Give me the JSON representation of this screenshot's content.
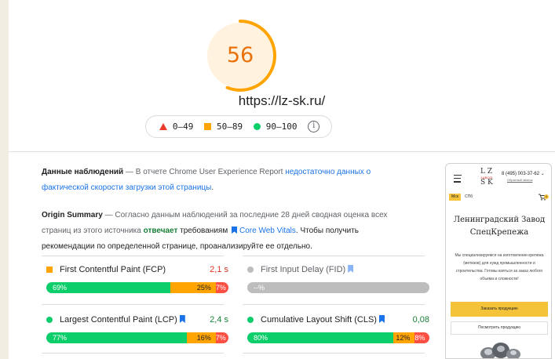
{
  "summary": {
    "score": "56",
    "score_fraction": 0.56,
    "score_color": "#e8710a",
    "url": "https://lz-sk.ru/",
    "legend": {
      "poor": "0–49",
      "average": "50–89",
      "good": "90–100",
      "info_icon": "i"
    }
  },
  "field_data": {
    "title": "Данные наблюдений",
    "dash": " — В отчете Chrome User Experience Report ",
    "link": "недостаточно данных о фактической скорости загрузки этой страницы",
    "end": "."
  },
  "origin": {
    "title": "Origin Summary",
    "text1": " — Согласно данным наблюдений за последние 28 дней сводная оценка всех страниц из этого источника ",
    "status": "отвечает",
    "text2": " требованиям ",
    "cwv": "Core Web Vitals",
    "text3": ". Чтобы получить рекомендации по определенной странице, проанализируйте ее отдельно."
  },
  "metrics": {
    "fcp": {
      "name": "First Contentful Paint (FCP)",
      "value": "2,1 s",
      "value_color": "#d93025",
      "good": "69%",
      "avg": "25%",
      "poor": "7%",
      "good_pct": 69,
      "avg_pct": 25,
      "poor_pct": 7
    },
    "fid": {
      "name": "First Input Delay (FID)",
      "value": "",
      "na": "--%"
    },
    "lcp": {
      "name": "Largest Contentful Paint (LCP)",
      "value": "2,4 s",
      "value_color": "#188038",
      "good": "77%",
      "avg": "16%",
      "poor": "7%",
      "good_pct": 77,
      "avg_pct": 16,
      "poor_pct": 7
    },
    "cls": {
      "name": "Cumulative Layout Shift (CLS)",
      "value": "0,08",
      "value_color": "#188038",
      "good": "80%",
      "avg": "12%",
      "poor": "8%",
      "good_pct": 80,
      "avg_pct": 12,
      "poor_pct": 8
    }
  },
  "preview": {
    "logo_top": "L Z",
    "logo_mid": "ЗАВОД",
    "logo_bottom": "S K",
    "phone": "8 (495) 003-37-62 ⌄",
    "callback": "Обратный звонок",
    "lang_a": "Мск",
    "lang_b": "СПб",
    "cart_count": "0",
    "title": "Ленинградский Завод СпецКрепежа",
    "description": "Мы специализируемся на изготовлении крепежа (метизов) для нужд промышленности и строительства. Готовы взяться за заказ любого объема и сложности!",
    "order_button": "Заказать продукцию",
    "view_button": "Посмотреть продукцию"
  }
}
